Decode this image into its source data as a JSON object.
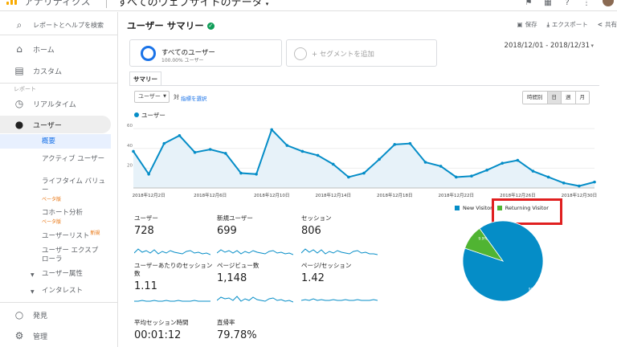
{
  "app": {
    "product": "アナリティクス",
    "view_name": "すべてのウェブサイトのデータ"
  },
  "sidebar": {
    "search": "レポートとヘルプを検索",
    "home": "ホーム",
    "custom": "カスタム",
    "section_reports": "レポート",
    "realtime": "リアルタイム",
    "audience": "ユーザー",
    "overview": "概要",
    "active_users": "アクティブ ユーザー",
    "lifetime_value": "ライフタイム バリュー",
    "cohort": "コホート分析",
    "beta": "ベータ版",
    "new": "新規",
    "user_list": "ユーザーリスト",
    "user_explorer": "ユーザー エクスプローラ",
    "demographics": "ユーザー属性",
    "interests": "インタレスト",
    "discover": "発見",
    "admin": "管理"
  },
  "header": {
    "title": "ユーザー サマリー",
    "save": "保存",
    "export": "エクスポート",
    "share": "共有"
  },
  "segments": {
    "all_users": "すべてのユーザー",
    "all_users_pct": "100.00% ユーザー",
    "add_segment": "+ セグメントを追加"
  },
  "date_range": "2018/12/01 - 2018/12/31",
  "tabs": [
    "サマリー"
  ],
  "controls": {
    "metric": "ユーザー",
    "vs": "対",
    "select_metric": "指標を選択",
    "granularity": [
      "時間別",
      "日",
      "週",
      "月"
    ],
    "granularity_active": "日"
  },
  "chart_data": [
    {
      "type": "line",
      "series": [
        {
          "name": "ユーザー",
          "values": [
            37,
            14,
            45,
            53,
            36,
            39,
            35,
            15,
            14,
            59,
            43,
            37,
            33,
            24,
            11,
            15,
            29,
            44,
            45,
            26,
            22,
            11,
            12,
            18,
            25,
            28,
            17,
            11,
            5,
            2,
            6
          ]
        }
      ],
      "x": [
        "2018年12月1日",
        "2018年12月2日",
        "2018年12月3日",
        "2018年12月4日",
        "2018年12月5日",
        "2018年12月6日",
        "2018年12月7日",
        "2018年12月8日",
        "2018年12月9日",
        "2018年12月10日",
        "2018年12月11日",
        "2018年12月12日",
        "2018年12月13日",
        "2018年12月14日",
        "2018年12月15日",
        "2018年12月16日",
        "2018年12月17日",
        "2018年12月18日",
        "2018年12月19日",
        "2018年12月20日",
        "2018年12月21日",
        "2018年12月22日",
        "2018年12月23日",
        "2018年12月24日",
        "2018年12月25日",
        "2018年12月26日",
        "2018年12月27日",
        "2018年12月28日",
        "2018年12月29日",
        "2018年12月30日",
        "2018年12月31日"
      ],
      "x_tick_labels": [
        "2018年12月2日",
        "2018年12月6日",
        "2018年12月10日",
        "2018年12月14日",
        "2018年12月18日",
        "2018年12月22日",
        "2018年12月26日",
        "2018年12月30日"
      ],
      "y_tick_labels": [
        "60",
        "40",
        "20"
      ],
      "ylim": [
        0,
        65
      ],
      "color": "#058dc7"
    },
    {
      "type": "pie",
      "categories": [
        "New Visitor",
        "Returning Visitor"
      ],
      "values": [
        90.1,
        9.9
      ],
      "labels": [
        "90.1%",
        "9.9%"
      ],
      "colors": [
        "#058dc7",
        "#50b432"
      ]
    }
  ],
  "scorecards": [
    {
      "title": "ユーザー",
      "value": "728"
    },
    {
      "title": "新規ユーザー",
      "value": "699"
    },
    {
      "title": "セッション",
      "value": "806"
    },
    {
      "title": "ユーザーあたりのセッション数",
      "value": "1.11"
    },
    {
      "title": "ページビュー数",
      "value": "1,148"
    },
    {
      "title": "ページ/セッション",
      "value": "1.42"
    },
    {
      "title": "平均セッション時間",
      "value": "00:01:12"
    },
    {
      "title": "直帰率",
      "value": "79.78%"
    }
  ],
  "colors": {
    "accent": "#1a73e8",
    "series": "#058dc7",
    "returning": "#50b432",
    "highlight": "#e02020"
  }
}
